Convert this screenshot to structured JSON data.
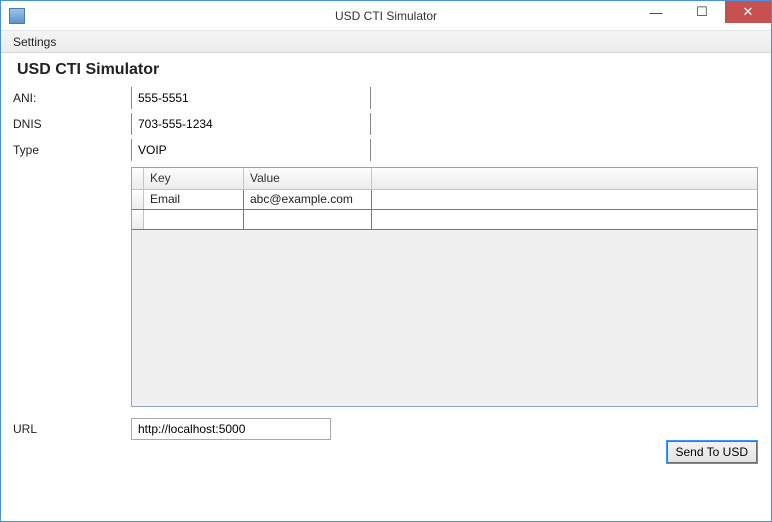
{
  "window": {
    "title": "USD CTI Simulator"
  },
  "menu": {
    "settings": "Settings"
  },
  "app": {
    "title": "USD CTI Simulator"
  },
  "fields": {
    "ani": {
      "label": "ANI:",
      "value": "555-5551"
    },
    "dnis": {
      "label": "DNIS",
      "value": "703-555-1234"
    },
    "type": {
      "label": "Type",
      "value": "VOIP"
    }
  },
  "grid": {
    "headers": {
      "key": "Key",
      "value": "Value"
    },
    "rows": [
      {
        "key": "Email",
        "value": "abc@example.com"
      },
      {
        "key": "",
        "value": ""
      }
    ]
  },
  "url": {
    "label": "URL",
    "value": "http://localhost:5000"
  },
  "buttons": {
    "send": "Send To USD"
  }
}
